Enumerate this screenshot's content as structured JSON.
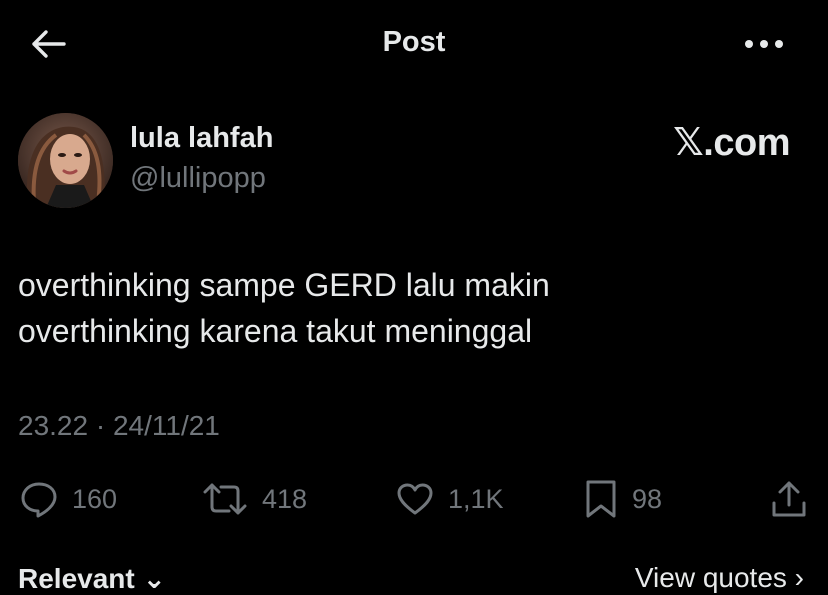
{
  "header": {
    "title": "Post",
    "back_icon": "arrow-left-icon",
    "more_icon": "more-horizontal-icon"
  },
  "author": {
    "name": "lula lahfah",
    "handle": "@lullipopp",
    "avatar": "avatar-photo"
  },
  "watermark": {
    "mark": "𝕏",
    "suffix": ".com"
  },
  "tweet": {
    "lines": [
      "overthinking sampe GERD lalu makin",
      "overthinking karena takut meninggal"
    ],
    "meta": "23.22 · 24/11/21"
  },
  "actions": {
    "reply": {
      "icon": "reply-icon",
      "count": "160"
    },
    "repost": {
      "icon": "repost-icon",
      "count": "418"
    },
    "like": {
      "icon": "heart-icon",
      "count": "1,1K"
    },
    "bookmark": {
      "icon": "bookmark-icon",
      "count": "98"
    },
    "share": {
      "icon": "share-icon"
    }
  },
  "footer": {
    "relevant_label": "Relevant ⌄",
    "quotes_label": "View quotes ›"
  },
  "colors": {
    "background": "#000000",
    "text_primary": "#e7e9ea",
    "text_secondary": "#71767b"
  }
}
